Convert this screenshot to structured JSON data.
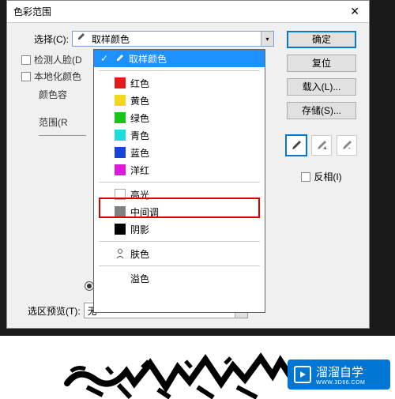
{
  "dialog": {
    "title": "色彩范围",
    "close": "✕"
  },
  "select_label": "选择(C):",
  "select_value": "取样颜色",
  "detect_face": "检测人脸(D",
  "localized": "本地化颜色",
  "color_tolerance": "颜色容",
  "range": "范围(R",
  "preview_label": "选区预览(T):",
  "preview_value": "无",
  "buttons": {
    "ok": "确定",
    "reset": "复位",
    "load": "载入(L)...",
    "save": "存储(S)..."
  },
  "invert": "反相(I)",
  "dropdown": {
    "sampled": "取样颜色",
    "red": "红色",
    "yellow": "黄色",
    "green": "绿色",
    "cyan": "青色",
    "blue": "蓝色",
    "magenta": "洋红",
    "highlights": "高光",
    "midtones": "中间调",
    "shadows": "阴影",
    "skin": "肤色",
    "outofgamut": "溢色"
  },
  "colors": {
    "red": "#e41919",
    "yellow": "#f3d817",
    "green": "#17c41a",
    "cyan": "#1bdde0",
    "blue": "#1445d8",
    "magenta": "#e018d8",
    "white": "#ffffff",
    "gray": "#808080",
    "black": "#000000"
  },
  "watermark": {
    "text": "溜溜自学",
    "sub": "WWW.3D66.COM"
  }
}
